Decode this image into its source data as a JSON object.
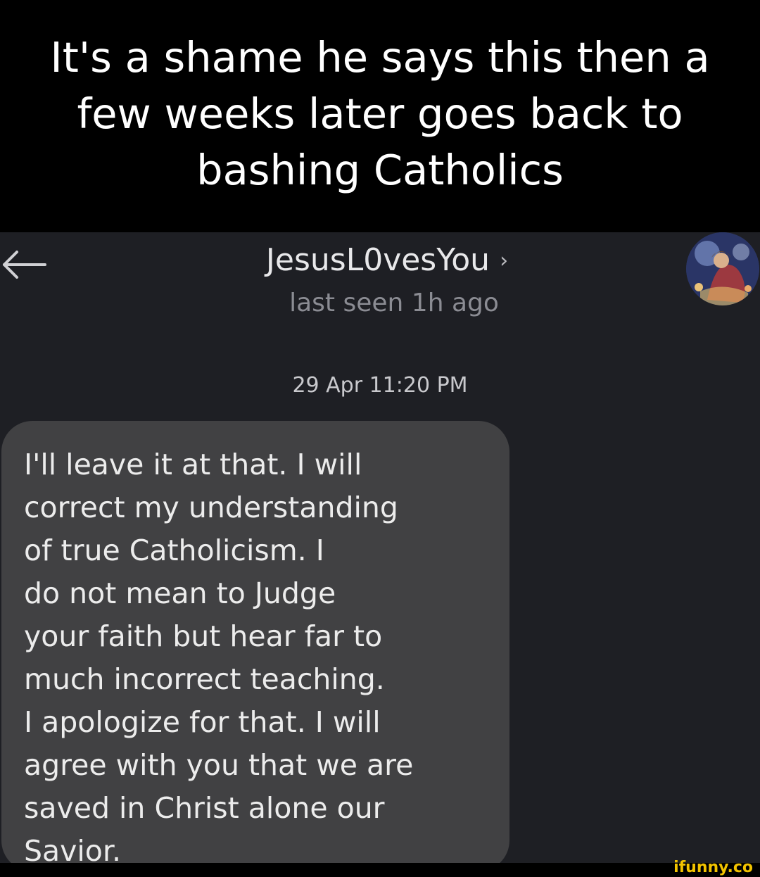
{
  "caption": {
    "text": "It's a shame he says this then a few weeks later goes back to bashing Catholics"
  },
  "header": {
    "contact_name": "JesusL0vesYou",
    "chevron": "›",
    "last_seen": "last seen 1h ago",
    "back_icon": "arrow-left-icon",
    "avatar": "contact-avatar"
  },
  "conversation": {
    "timestamp": "29 Apr 11:20 PM",
    "messages": [
      {
        "direction": "incoming",
        "text": "I'll leave it at that. I will\ncorrect my understanding\nof true Catholicism. I\ndo not mean to Judge\nyour faith but hear far to\nmuch incorrect teaching.\nI apologize for that. I will\nagree with you that we are\nsaved in Christ alone our\nSavior."
      }
    ]
  },
  "watermark": {
    "text": "ifunny.co"
  },
  "colors": {
    "caption_bg": "#000000",
    "chat_bg": "#1e1f24",
    "bubble_bg": "#414143",
    "watermark": "#f2c300"
  }
}
